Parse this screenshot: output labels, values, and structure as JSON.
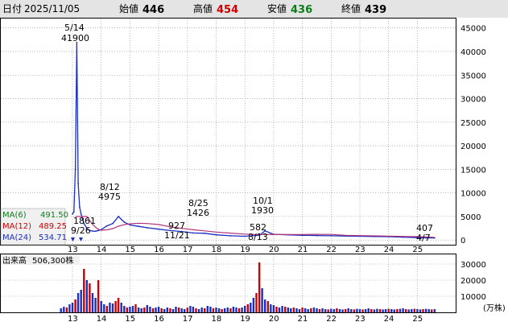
{
  "header": {
    "date_label": "日付",
    "date_value": "2025/11/05",
    "open_label": "始値",
    "open_value": "446",
    "high_label": "高値",
    "high_value": "454",
    "low_label": "安値",
    "low_value": "436",
    "close_label": "終値",
    "close_value": "439"
  },
  "colors": {
    "up": "#cc0000",
    "down": "#1a2fbf",
    "ma6": "#0b7d1a",
    "ma12": "#cc0000",
    "ma24": "#1a2fbf",
    "ma_line": "#b0337a",
    "grid": "#8a8a8a",
    "header_bg": "#e4e4e4",
    "ma_box_bg": "#f0f0f0"
  },
  "moving_averages": [
    {
      "label": "MA(6)",
      "value": "491.50"
    },
    {
      "label": "MA(12)",
      "value": "489.25"
    },
    {
      "label": "MA(24)",
      "value": "534.71"
    }
  ],
  "volume": {
    "label": "出来高",
    "value": "506,300株",
    "unit": "(万株)"
  },
  "annotations": [
    {
      "date": "5/14",
      "value": "41900"
    },
    {
      "date": "9/26",
      "value": "1861"
    },
    {
      "date": "8/12",
      "value": "4975"
    },
    {
      "date": "11/21",
      "value": "927"
    },
    {
      "date": "8/25",
      "value": "1426"
    },
    {
      "date": "10/1",
      "value": "1930"
    },
    {
      "date": "8/13",
      "value": "582"
    },
    {
      "date": "4/7",
      "value": "407"
    }
  ],
  "chart_data": [
    {
      "type": "line",
      "title": "",
      "xlabel": "",
      "ylabel": "",
      "x_ticks": [
        "13",
        "14",
        "15",
        "16",
        "17",
        "18",
        "19",
        "20",
        "21",
        "22",
        "23",
        "24",
        "25"
      ],
      "y_ticks": [
        0,
        5000,
        10000,
        15000,
        20000,
        25000,
        30000,
        35000,
        40000,
        45000
      ],
      "ylim": [
        -1000,
        47000
      ],
      "grid": true,
      "series": [
        {
          "name": "",
          "x": [
            13.0,
            13.05,
            13.1,
            13.15,
            13.2,
            13.25,
            13.3,
            13.35,
            13.4,
            13.5,
            13.6,
            13.7,
            13.8,
            13.9,
            14.0,
            14.2,
            14.4,
            14.6,
            14.8,
            15.0,
            15.3,
            15.6,
            16.0,
            16.4,
            16.8,
            17.2,
            17.6,
            18.0,
            18.5,
            19.0,
            19.5,
            19.7,
            20.0,
            20.5,
            21.0,
            21.5,
            22.0,
            22.5,
            23.0,
            23.5,
            24.0,
            24.5,
            25.0,
            25.3,
            25.6
          ],
          "values": [
            5500,
            6000,
            15000,
            41900,
            12000,
            7000,
            5500,
            4500,
            3500,
            2500,
            2000,
            1900,
            1861,
            2000,
            2200,
            3000,
            3500,
            4975,
            3800,
            3200,
            2900,
            2600,
            2300,
            2000,
            1800,
            1500,
            1426,
            1100,
            900,
            800,
            1000,
            1930,
            1200,
            1100,
            1000,
            950,
            900,
            850,
            800,
            750,
            700,
            600,
            500,
            450,
            439
          ]
        }
      ]
    },
    {
      "type": "bar",
      "title": "",
      "xlabel": "",
      "ylabel": "(万株)",
      "x_ticks": [
        "13",
        "14",
        "15",
        "16",
        "17",
        "18",
        "19",
        "20",
        "21",
        "22",
        "23",
        "24",
        "25"
      ],
      "y_ticks": [
        10000,
        20000,
        30000
      ],
      "ylim": [
        0,
        36000
      ],
      "grid": true,
      "series": [
        {
          "name": "出来高",
          "x": [
            12.6,
            12.7,
            12.8,
            12.9,
            13.0,
            13.1,
            13.2,
            13.3,
            13.4,
            13.5,
            13.6,
            13.7,
            13.8,
            13.9,
            14.0,
            14.1,
            14.2,
            14.3,
            14.4,
            14.5,
            14.6,
            14.7,
            14.8,
            14.9,
            15.0,
            15.1,
            15.2,
            15.3,
            15.4,
            15.5,
            15.6,
            15.7,
            15.8,
            15.9,
            16.0,
            16.1,
            16.2,
            16.3,
            16.4,
            16.5,
            16.6,
            16.7,
            16.8,
            16.9,
            17.0,
            17.1,
            17.2,
            17.3,
            17.4,
            17.5,
            17.6,
            17.7,
            17.8,
            17.9,
            18.0,
            18.1,
            18.2,
            18.3,
            18.4,
            18.5,
            18.6,
            18.7,
            18.8,
            18.9,
            19.0,
            19.1,
            19.2,
            19.3,
            19.4,
            19.5,
            19.6,
            19.7,
            19.8,
            19.9,
            20.0,
            20.1,
            20.2,
            20.3,
            20.4,
            20.5,
            20.6,
            20.7,
            20.8,
            20.9,
            21.0,
            21.1,
            21.2,
            21.3,
            21.4,
            21.5,
            21.6,
            21.7,
            21.8,
            21.9,
            22.0,
            22.1,
            22.2,
            22.3,
            22.4,
            22.5,
            22.6,
            22.7,
            22.8,
            22.9,
            23.0,
            23.1,
            23.2,
            23.3,
            23.4,
            23.5,
            23.6,
            23.7,
            23.8,
            23.9,
            24.0,
            24.1,
            24.2,
            24.3,
            24.4,
            24.5,
            24.6,
            24.7,
            24.8,
            24.9,
            25.0,
            25.1,
            25.2,
            25.3,
            25.4,
            25.5,
            25.6
          ],
          "values": [
            2500,
            3500,
            3000,
            5000,
            6000,
            8000,
            12000,
            14000,
            27000,
            20000,
            18000,
            12000,
            9000,
            20000,
            7000,
            5000,
            4000,
            6000,
            5500,
            7000,
            9000,
            6000,
            4000,
            3000,
            3500,
            4000,
            5000,
            3000,
            2500,
            3000,
            4500,
            3500,
            2500,
            3000,
            3500,
            2500,
            2000,
            3000,
            2500,
            2000,
            3500,
            3000,
            2500,
            2000,
            3000,
            4000,
            3500,
            2500,
            2000,
            3000,
            2500,
            4000,
            3500,
            2500,
            3000,
            2500,
            2000,
            2500,
            3000,
            2500,
            3500,
            3000,
            2500,
            3000,
            4000,
            5000,
            6000,
            9000,
            12000,
            31000,
            15000,
            8000,
            7000,
            5000,
            4500,
            3500,
            3000,
            4000,
            3500,
            3000,
            2500,
            3000,
            2500,
            2000,
            3000,
            2500,
            2000,
            2500,
            3000,
            2500,
            2000,
            2500,
            2000,
            1800,
            2200,
            2000,
            2500,
            2000,
            1800,
            2000,
            2500,
            2000,
            1800,
            2200,
            2000,
            1800,
            2000,
            2500,
            2000,
            1800,
            2200,
            2000,
            1800,
            2000,
            2200,
            2000,
            1800,
            2000,
            2200,
            2500,
            2000,
            1800,
            2000,
            2200,
            2000,
            1800,
            2000,
            2200,
            2000,
            1800,
            2000
          ],
          "up": [
            false,
            false,
            true,
            false,
            false,
            true,
            false,
            false,
            true,
            false,
            true,
            false,
            false,
            true,
            false,
            false,
            true,
            false,
            false,
            true,
            true,
            false,
            false,
            true,
            false,
            false,
            true,
            false,
            false,
            true,
            false,
            false,
            true,
            false,
            false,
            true,
            false,
            false,
            true,
            false,
            false,
            true,
            false,
            false,
            true,
            false,
            false,
            true,
            false,
            false,
            true,
            false,
            false,
            true,
            false,
            false,
            true,
            false,
            false,
            true,
            false,
            false,
            true,
            false,
            false,
            true,
            false,
            false,
            true,
            true,
            false,
            false,
            true,
            false,
            false,
            true,
            false,
            false,
            true,
            false,
            false,
            true,
            false,
            false,
            true,
            false,
            false,
            true,
            false,
            false,
            true,
            false,
            false,
            true,
            false,
            false,
            true,
            false,
            false,
            true,
            false,
            false,
            true,
            false,
            false,
            true,
            false,
            false,
            true,
            false,
            false,
            true,
            false,
            false,
            true,
            false,
            false,
            true,
            false,
            false,
            true,
            false,
            false,
            true,
            false,
            false,
            true,
            false,
            false,
            true,
            false
          ]
        }
      ]
    }
  ]
}
